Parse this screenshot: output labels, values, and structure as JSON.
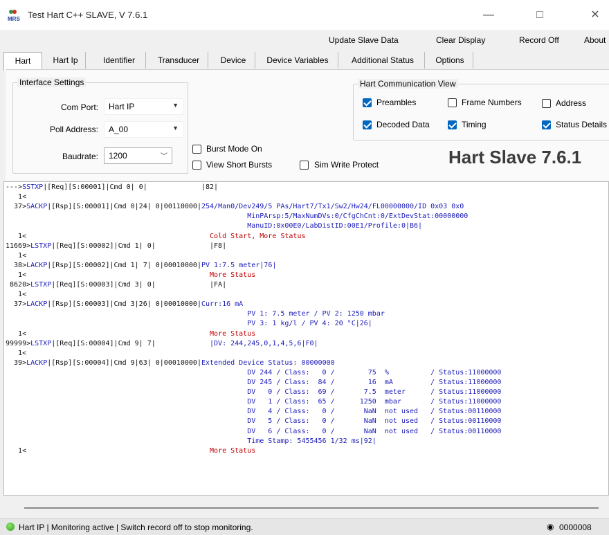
{
  "window": {
    "title": "Test Hart C++ SLAVE, V 7.6.1",
    "logo_text": "MRS",
    "minimize": "—",
    "maximize": "□",
    "close": "✕"
  },
  "menu": {
    "update": "Update Slave Data",
    "clear": "Clear Display",
    "record": "Record Off",
    "about": "About"
  },
  "tabs": [
    "Hart",
    "Hart Ip",
    "Identifier",
    "Transducer",
    "Device",
    "Device Variables",
    "Additional Status",
    "Options"
  ],
  "interface": {
    "title": "Interface Settings",
    "com_port_label": "Com Port:",
    "com_port_value": "Hart IP",
    "poll_label": "Poll Address:",
    "poll_value": "A_00",
    "baud_label": "Baudrate:",
    "baud_value": "1200"
  },
  "options": {
    "burst_mode": "Burst Mode On",
    "short_bursts": "View Short Bursts",
    "sim_write": "Sim Write Protect"
  },
  "comm_view": {
    "title": "Hart Communication View",
    "preambles": "Preambles",
    "frame_numbers": "Frame Numbers",
    "address": "Address",
    "decoded": "Decoded Data",
    "timing": "Timing",
    "status_details": "Status Details"
  },
  "banner": "Hart Slave 7.6.1",
  "log": [
    [
      {
        "c": "k",
        "t": "--->"
      },
      {
        "c": "b",
        "t": "SSTXP"
      },
      {
        "c": "k",
        "t": "|[Req][S:00001]|Cmd 0| 0|             |82|"
      }
    ],
    [
      {
        "c": "k",
        "t": "   1<"
      }
    ],
    [
      {
        "c": "k",
        "t": "  37>"
      },
      {
        "c": "b",
        "t": "SACKP"
      },
      {
        "c": "k",
        "t": "|[Rsp][S:00001]|Cmd 0|24| 0|00110000|"
      },
      {
        "c": "b",
        "t": "254/Man0/Dev249/5 PAs/Hart7/Tx1/Sw2/Hw24/FL00000000/ID 0x03 0x0"
      }
    ],
    [
      {
        "c": "b",
        "t": "                                                          MinPArsp:5/MaxNumDVs:0/CfgChCnt:0/ExtDevStat:00000000"
      }
    ],
    [
      {
        "c": "b",
        "t": "                                                          ManuID:0x00E0/LabDistID:00E1/Profile:0|B6|"
      }
    ],
    [
      {
        "c": "k",
        "t": "   1<                                            "
      },
      {
        "c": "r",
        "t": "Cold Start, More Status"
      }
    ],
    [
      {
        "c": "k",
        "t": "11669>"
      },
      {
        "c": "b",
        "t": "LSTXP"
      },
      {
        "c": "k",
        "t": "|[Req][S:00002]|Cmd 1| 0|             |F8|"
      }
    ],
    [
      {
        "c": "k",
        "t": "   1<"
      }
    ],
    [
      {
        "c": "k",
        "t": "  38>"
      },
      {
        "c": "b",
        "t": "LACKP"
      },
      {
        "c": "k",
        "t": "|[Rsp][S:00002]|Cmd 1| 7| 0|00010000|"
      },
      {
        "c": "b",
        "t": "PV 1:7.5 meter|76|"
      }
    ],
    [
      {
        "c": "k",
        "t": "   1<                                            "
      },
      {
        "c": "r",
        "t": "More Status"
      }
    ],
    [
      {
        "c": "k",
        "t": " 8620>"
      },
      {
        "c": "b",
        "t": "LSTXP"
      },
      {
        "c": "k",
        "t": "|[Req][S:00003]|Cmd 3| 0|             |FA|"
      }
    ],
    [
      {
        "c": "k",
        "t": "   1<"
      }
    ],
    [
      {
        "c": "k",
        "t": "  37>"
      },
      {
        "c": "b",
        "t": "LACKP"
      },
      {
        "c": "k",
        "t": "|[Rsp][S:00003]|Cmd 3|26| 0|00010000|"
      },
      {
        "c": "b",
        "t": "Curr:16 mA"
      }
    ],
    [
      {
        "c": "b",
        "t": "                                                          PV 1: 7.5 meter / PV 2: 1250 mbar"
      }
    ],
    [
      {
        "c": "b",
        "t": "                                                          PV 3: 1 kg/l / PV 4: 20 °C|26|"
      }
    ],
    [
      {
        "c": "k",
        "t": "   1<                                            "
      },
      {
        "c": "r",
        "t": "More Status"
      }
    ],
    [
      {
        "c": "k",
        "t": "99999>"
      },
      {
        "c": "b",
        "t": "LSTXP"
      },
      {
        "c": "k",
        "t": "|[Req][S:00004]|Cmd 9| 7|             "
      },
      {
        "c": "b",
        "t": "|DV: 244,245,0,1,4,5,6|F0|"
      }
    ],
    [
      {
        "c": "k",
        "t": "   1<"
      }
    ],
    [
      {
        "c": "k",
        "t": "  39>"
      },
      {
        "c": "b",
        "t": "LACKP"
      },
      {
        "c": "k",
        "t": "|[Rsp][S:00004]|Cmd 9|63| 0|00010000|"
      },
      {
        "c": "b",
        "t": "Extended Device Status: 00000000"
      }
    ],
    [
      {
        "c": "b",
        "t": "                                                          DV 244 / Class:   0 /        75  %          / Status:11000000"
      }
    ],
    [
      {
        "c": "b",
        "t": "                                                          DV 245 / Class:  84 /        16  mA         / Status:11000000"
      }
    ],
    [
      {
        "c": "b",
        "t": "                                                          DV   0 / Class:  69 /       7.5  meter      / Status:11000000"
      }
    ],
    [
      {
        "c": "b",
        "t": "                                                          DV   1 / Class:  65 /      1250  mbar       / Status:11000000"
      }
    ],
    [
      {
        "c": "b",
        "t": "                                                          DV   4 / Class:   0 /       NaN  not used   / Status:00110000"
      }
    ],
    [
      {
        "c": "b",
        "t": "                                                          DV   5 / Class:   0 /       NaN  not used   / Status:00110000"
      }
    ],
    [
      {
        "c": "b",
        "t": "                                                          DV   6 / Class:   0 /       NaN  not used   / Status:00110000"
      }
    ],
    [
      {
        "c": "b",
        "t": "                                                          Time Stamp: 5455456 1/32 ms|92|"
      }
    ],
    [
      {
        "c": "k",
        "t": "   1<                                            "
      },
      {
        "c": "r",
        "t": "More Status"
      }
    ]
  ],
  "status": {
    "text": "Hart IP  | Monitoring active | Switch record off to stop monitoring.",
    "count": "0000008"
  },
  "colors": {
    "accent": "#0067c0",
    "log_blue": "#1a1ab8",
    "log_red": "#c00000",
    "led_green": "#2aa40e"
  }
}
